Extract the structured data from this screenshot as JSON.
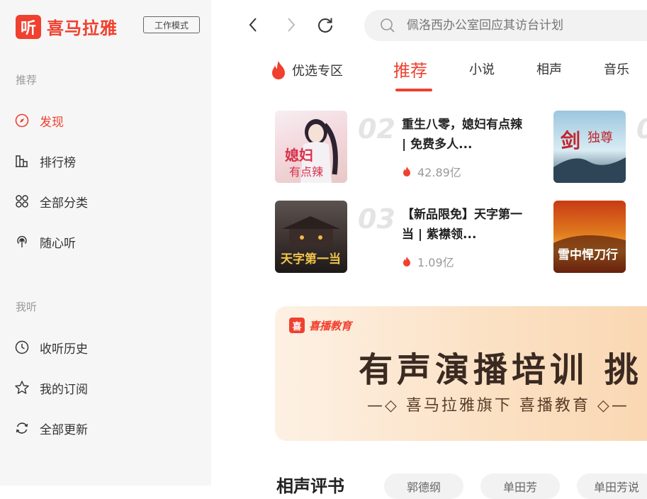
{
  "app": {
    "logo_char": "听",
    "logo_text": "喜马拉雅",
    "mode_badge": "工作模式"
  },
  "sidebar": {
    "section_recommend": "推荐",
    "section_mine": "我听",
    "recommend_items": [
      {
        "label": "发现",
        "icon": "compass-icon",
        "active": true
      },
      {
        "label": "排行榜",
        "icon": "chart-bars-icon"
      },
      {
        "label": "全部分类",
        "icon": "grid-circles-icon"
      },
      {
        "label": "随心听",
        "icon": "radio-icon"
      }
    ],
    "mine_items": [
      {
        "label": "收听历史",
        "icon": "clock-icon"
      },
      {
        "label": "我的订阅",
        "icon": "star-icon"
      },
      {
        "label": "全部更新",
        "icon": "refresh-icon"
      }
    ]
  },
  "search": {
    "placeholder": "佩洛西办公室回应其访台计划"
  },
  "tabs": [
    "优选专区",
    "推荐",
    "小说",
    "相声",
    "音乐"
  ],
  "ranking": [
    {
      "rank": "02",
      "title": "重生八零，媳妇有点辣 | 免费多人...",
      "plays": "42.89亿"
    },
    {
      "rank": "03",
      "title": "【新品限免】天字第一当 | 紫襟领...",
      "plays": "1.09亿"
    }
  ],
  "ranking_right_rank_prefix": "0",
  "banner": {
    "logo_char": "喜",
    "logo_text": "喜播教育",
    "title": "有声演播培训 挑",
    "subtitle": "—◇ 喜马拉雅旗下 喜播教育 ◇—"
  },
  "bottom": {
    "title": "相声评书",
    "chips": [
      "郭德纲",
      "单田芳",
      "单田芳说"
    ]
  },
  "colors": {
    "accent": "#f0402f",
    "sidebar_bg": "#f6f6f6"
  }
}
